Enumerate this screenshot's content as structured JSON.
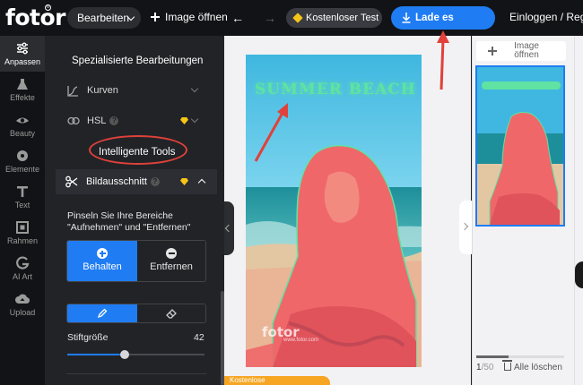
{
  "app": {
    "logo": "fotor",
    "logo_reg": "®"
  },
  "topbar": {
    "edit_menu": "Bearbeiten",
    "open_image": "Image öffnen",
    "free_trial": "Kostenloser Test",
    "download": "Lade es herunter",
    "login": "Einloggen / Regi"
  },
  "rail": {
    "items": [
      {
        "label": "Anpassen",
        "icon": "sliders-icon"
      },
      {
        "label": "Effekte",
        "icon": "flask-icon"
      },
      {
        "label": "Beauty",
        "icon": "eye-icon"
      },
      {
        "label": "Elemente",
        "icon": "shapes-icon"
      },
      {
        "label": "Text",
        "icon": "text-icon"
      },
      {
        "label": "Rahmen",
        "icon": "frame-icon"
      },
      {
        "label": "AI Art",
        "icon": "ai-art-icon"
      },
      {
        "label": "Upload",
        "icon": "upload-icon"
      }
    ]
  },
  "panel": {
    "title": "Spezialisierte Bearbeitungen",
    "curves": "Kurven",
    "hsl": "HSL",
    "hsl_help": "?",
    "intelligent_tools": "Intelligente Tools",
    "cutout": "Bildausschnitt",
    "cutout_help": "?",
    "hint_line1": "Pinseln Sie Ihre Bereiche",
    "hint_line2": "\"Aufnehmen\" und \"Entfernen\"",
    "keep": "Behalten",
    "remove": "Entfernen",
    "brush_size_label": "Stiftgröße",
    "brush_size_value": "42",
    "brush_size_fraction": 0.42
  },
  "canvas": {
    "overlay_text": "SUMMER BEACH",
    "watermark": "fotor",
    "watermark_sub": "www.fotor.com",
    "bottom_badge": "Kostenlose"
  },
  "right": {
    "add_image": "Image öffnen",
    "page_current": "1",
    "page_sep": "/",
    "page_total": "50",
    "delete_all": "Alle löschen",
    "thumb_progress": 0.37
  },
  "colors": {
    "accent": "#1f7cf3",
    "gem": "#f5c518",
    "annotation": "#e0413a",
    "mask": "#f0676a",
    "text_green": "#5fe2a2"
  }
}
